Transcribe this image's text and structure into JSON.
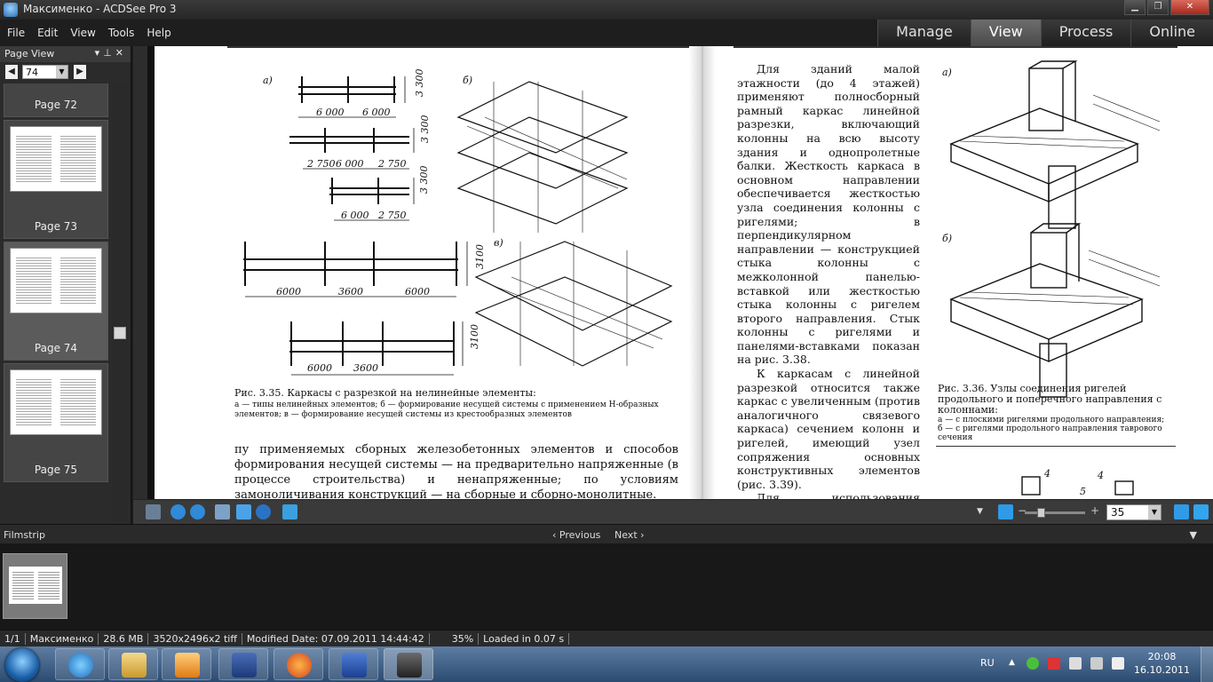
{
  "window": {
    "title": "Максименко - ACDSee Pro 3"
  },
  "menu": {
    "file": "File",
    "edit": "Edit",
    "view": "View",
    "tools": "Tools",
    "help": "Help"
  },
  "modes": {
    "manage": "Manage",
    "view": "View",
    "process": "Process",
    "online": "Online"
  },
  "page_view": {
    "title": "Page View",
    "page_number": "74",
    "thumbnails": [
      "Page 72",
      "Page 73",
      "Page 74",
      "Page 75"
    ]
  },
  "document": {
    "fig_left_labels": {
      "a": "а)",
      "b": "б)",
      "v": "в)"
    },
    "dims": {
      "d6000": "6 000",
      "d3300": "3 300",
      "d2750": "2 750",
      "d6000b": "6000",
      "d3600": "3600",
      "d3100": "3100"
    },
    "fig_left_caption": "Рис. 3.35. Каркасы с разрезкой на нелинейные элементы:",
    "fig_left_sub": "а — типы нелинейных элементов; б — формирование несущей системы с применением Н-образных элементов; в — формирование несущей системы из крестообразных элементов",
    "body_left": "пу применяемых сборных железобетонных элементов и способов формирования несущей системы — на предварительно напряженные (в процессе строительства) и ненапряженные; по условиям замоноличивания конструкций — на сборные и сборно-монолитные.",
    "body_right_p1": "Для зданий малой этажности (до 4 этажей) применяют полносборный рамный каркас линейной разрезки, включающий колонны на всю высоту здания и однопролетные балки. Жесткость каркаса в основном направлении обеспечивается жесткостью узла соединения колонны с ригелями; в перпендикулярном направлении — конструкцией стыка колонны с межколонной панелью-вставкой или жесткостью стыка колонны с ригелем второго направления. Стык колонны с ригелями и панелями-вставками показан на рис. 3.38.",
    "body_right_p2": "К каркасам с линейной разрезкой относится также каркас с увеличенным (против аналогичного связевого каркаса) сечением колонн и ригелей, имеющий узел сопряжения основных конструктивных элементов (рис. 3.39).",
    "body_right_p3": "Для использования бортоснастки для производства элементов конструктивной",
    "fig_right_labels": {
      "a": "а)",
      "b": "б)",
      "n4": "4",
      "n5": "5"
    },
    "fig_right_caption": "Рис. 3.36. Узлы соединения ригелей продольного и поперечного направления с колоннами:",
    "fig_right_sub": "а — с плоскими ригелями продольного направления; б — с ригелями продольного направления таврового сечения"
  },
  "toolbar": {
    "zoom": "35"
  },
  "filmstrip": {
    "title": "Filmstrip",
    "previous": "Previous",
    "next": "Next"
  },
  "status": {
    "index": "1/1",
    "name": "Максименко",
    "size": "28.6 MB",
    "dims": "3520x2496x2 tiff",
    "modified": "Modified Date: 07.09.2011 14:44:42",
    "zoom": "35%",
    "loaded": "Loaded in 0.07 s"
  },
  "taskbar": {
    "lang": "RU",
    "time": "20:08",
    "date": "16.10.2011"
  }
}
